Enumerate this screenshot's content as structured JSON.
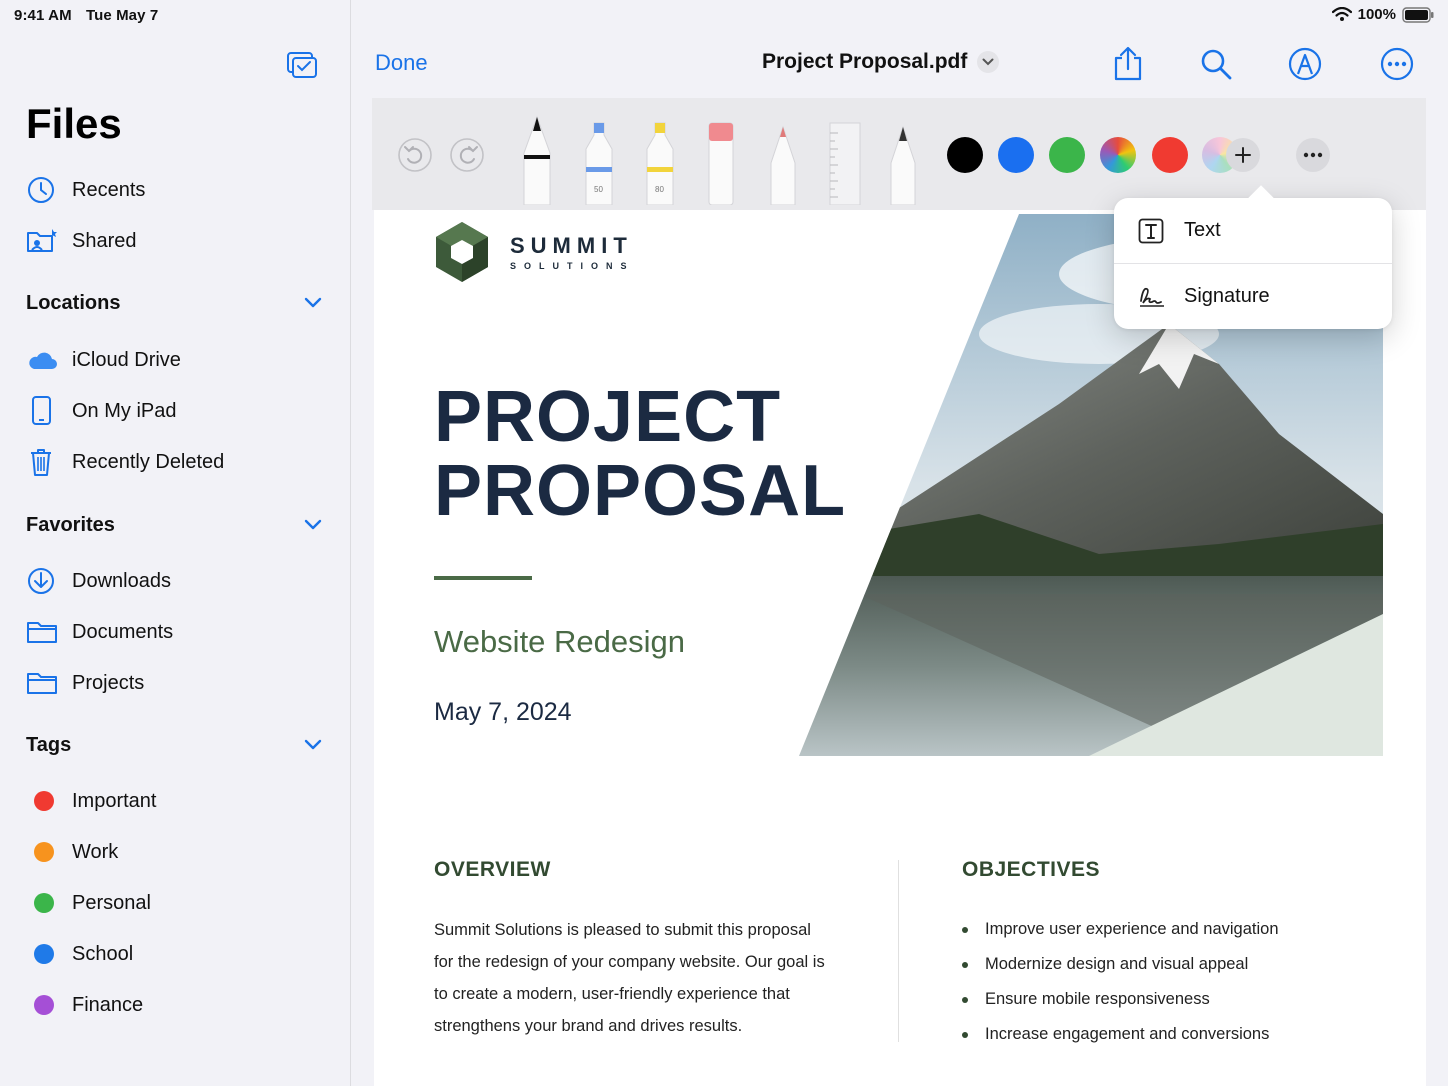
{
  "status": {
    "time": "9:41 AM",
    "date": "Tue May 7",
    "battery": "100%"
  },
  "sidebar": {
    "title": "Files",
    "top_items": [
      {
        "label": "Recents",
        "icon": "clock-icon"
      },
      {
        "label": "Shared",
        "icon": "shared-folder-icon"
      }
    ],
    "sections": {
      "locations": {
        "title": "Locations",
        "items": [
          {
            "label": "iCloud Drive",
            "icon": "cloud-icon"
          },
          {
            "label": "On My iPad",
            "icon": "ipad-icon"
          },
          {
            "label": "Recently Deleted",
            "icon": "trash-icon"
          }
        ]
      },
      "favorites": {
        "title": "Favorites",
        "items": [
          {
            "label": "Downloads",
            "icon": "download-icon"
          },
          {
            "label": "Documents",
            "icon": "folder-icon"
          },
          {
            "label": "Projects",
            "icon": "folder-icon"
          }
        ]
      },
      "tags": {
        "title": "Tags",
        "items": [
          {
            "label": "Important",
            "color": "#f03a31"
          },
          {
            "label": "Work",
            "color": "#f7931e"
          },
          {
            "label": "Personal",
            "color": "#3bb54a"
          },
          {
            "label": "School",
            "color": "#1f7ae8"
          },
          {
            "label": "Finance",
            "color": "#a54fd6"
          }
        ]
      }
    }
  },
  "header": {
    "done": "Done",
    "doc_title": "Project Proposal.pdf",
    "buttons": [
      "share-icon",
      "search-icon",
      "markup-icon",
      "more-icon"
    ]
  },
  "toolbar": {
    "pen_labels": [
      "50",
      "80"
    ],
    "colors": [
      "#000000",
      "#1a6ff0",
      "#3bb54a",
      "multicolor",
      "#f03a31"
    ]
  },
  "popover": {
    "items": [
      {
        "label": "Text",
        "icon": "text-box-icon"
      },
      {
        "label": "Signature",
        "icon": "signature-icon"
      }
    ]
  },
  "document": {
    "company": "SUMMIT",
    "company_sub": "SOLUTIONS",
    "title_line1": "PROJECT",
    "title_line2": "PROPOSAL",
    "subtitle": "Website Redesign",
    "date": "May 7, 2024",
    "overview_heading": "OVERVIEW",
    "overview_text": "Summit Solutions is pleased to submit this proposal for the redesign of your company website. Our goal is to create a modern, user-friendly experience that strengthens your brand and drives results.",
    "objectives_heading": "OBJECTIVES",
    "objectives": [
      "Improve user experience and navigation",
      "Modernize design and visual appeal",
      "Ensure mobile responsiveness",
      "Increase engagement and conversions"
    ]
  }
}
